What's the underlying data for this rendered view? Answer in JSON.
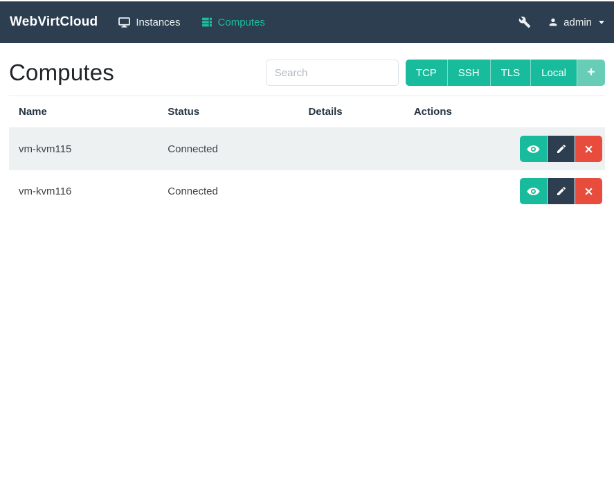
{
  "navbar": {
    "brand": "WebVirtCloud",
    "items": [
      {
        "label": "Instances"
      },
      {
        "label": "Computes"
      }
    ],
    "user": "admin"
  },
  "page": {
    "title": "Computes"
  },
  "search": {
    "placeholder": "Search"
  },
  "toolbar": {
    "connection_buttons": [
      "TCP",
      "SSH",
      "TLS",
      "Local"
    ],
    "add_label": "+"
  },
  "table": {
    "headers": [
      "Name",
      "Status",
      "Details",
      "Actions"
    ],
    "rows": [
      {
        "name": "vm-kvm115",
        "status": "Connected",
        "details": ""
      },
      {
        "name": "vm-kvm116",
        "status": "Connected",
        "details": ""
      }
    ]
  },
  "colors": {
    "navbar_bg": "#2C3E50",
    "accent_teal": "#18BC9C",
    "accent_teal_light": "#68CDB7",
    "dark_button": "#2C3E50",
    "danger_red": "#E74C3C",
    "stripe": "#EEF1F2"
  }
}
